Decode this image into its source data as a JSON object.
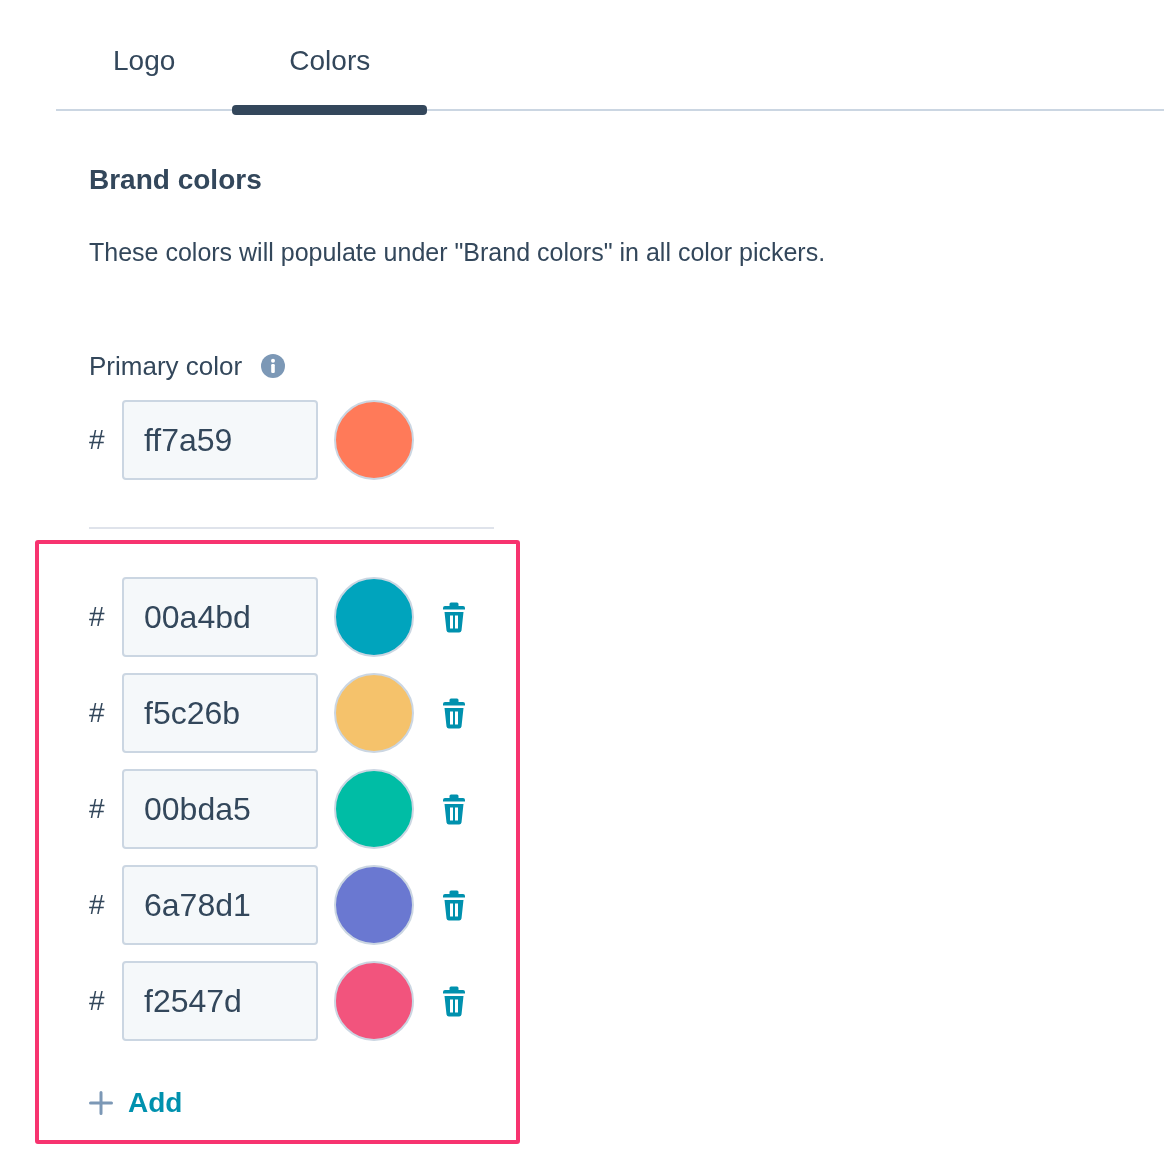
{
  "tabs": [
    {
      "label": "Logo",
      "selected": false
    },
    {
      "label": "Colors",
      "selected": true
    }
  ],
  "section": {
    "title": "Brand colors",
    "description": "These colors will populate under \"Brand colors\" in all color pickers."
  },
  "primary_color": {
    "label": "Primary color",
    "prefix": "#",
    "value": "ff7a59",
    "color": "#ff7a59"
  },
  "additional_colors": {
    "highlighted": true,
    "items": [
      {
        "prefix": "#",
        "value": "00a4bd",
        "color": "#00a4bd"
      },
      {
        "prefix": "#",
        "value": "f5c26b",
        "color": "#f5c26b"
      },
      {
        "prefix": "#",
        "value": "00bda5",
        "color": "#00bda5"
      },
      {
        "prefix": "#",
        "value": "6a78d1",
        "color": "#6a78d1"
      },
      {
        "prefix": "#",
        "value": "f2547d",
        "color": "#f2547d"
      }
    ],
    "add_button": {
      "label": "Add"
    }
  }
}
